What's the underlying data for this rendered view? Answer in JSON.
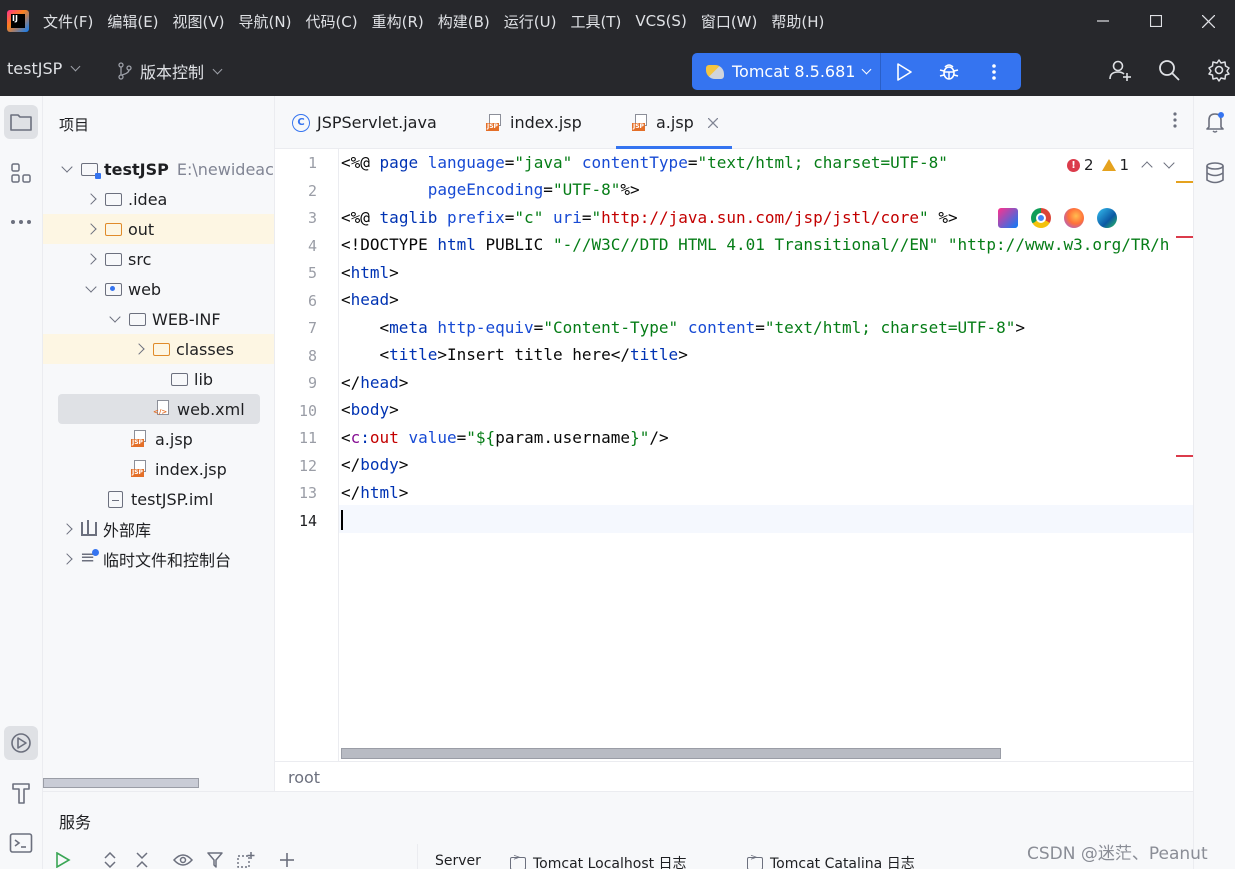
{
  "menu": {
    "items": [
      "文件(F)",
      "编辑(E)",
      "视图(V)",
      "导航(N)",
      "代码(C)",
      "重构(R)",
      "构建(B)",
      "运行(U)",
      "工具(T)",
      "VCS(S)",
      "窗口(W)",
      "帮助(H)"
    ]
  },
  "toolbar": {
    "project_name": "testJSP",
    "vcs_label": "版本控制",
    "run_config": "Tomcat 8.5.681"
  },
  "project_panel": {
    "title": "项目",
    "root_name": "testJSP",
    "root_path": "E:\\newideac",
    "tree": [
      "testJSP",
      ".idea",
      "out",
      "src",
      "web",
      "WEB-INF",
      "classes",
      "lib",
      "web.xml",
      "a.jsp",
      "index.jsp",
      "testJSP.iml",
      "外部库",
      "临时文件和控制台"
    ]
  },
  "editor": {
    "tabs": [
      "JSPServlet.java",
      "index.jsp",
      "a.jsp"
    ],
    "active_tab": "a.jsp",
    "error_count": "2",
    "warning_count": "1",
    "line_numbers": [
      "1",
      "2",
      "3",
      "4",
      "5",
      "6",
      "7",
      "8",
      "9",
      "10",
      "11",
      "12",
      "13",
      "14"
    ],
    "tokens": {
      "dir1": "<%@",
      "page": "page",
      "language": "language",
      "eq": "=",
      "java": "\"java\"",
      "contentType": "contentType",
      "ct_val": "\"text/html; charset=UTF-8\"",
      "indent2": "         ",
      "pageEncoding": "pageEncoding",
      "utf8": "\"UTF-8\"",
      "close_dir": "%>",
      "taglib": "taglib",
      "prefix": "prefix",
      "c": "\"c\"",
      "uri": "uri",
      "q": "\"",
      "uri_val": "http://java.sun.com/jsp/jstl/core",
      "close_dir3": " %>",
      "doctype": "<!DOCTYPE",
      "html_kw": "html",
      "public": " PUBLIC ",
      "dtd": "\"-//W3C//DTD HTML 4.01 Transitional//EN\"",
      "dtd_url": " \"http://www.w3.org/TR/h",
      "lt": "<",
      "gt": ">",
      "lt_slash": "</",
      "head": "head",
      "meta": "meta",
      "http_equiv": "http-equiv",
      "ct_type": "\"Content-Type\"",
      "content": "content",
      "title": "title",
      "title_text": "Insert title here",
      "body": "body",
      "c_prefix": "c",
      "colon": ":",
      "out": "out",
      "value": "value",
      "el_open": "\"${",
      "el_param": "param",
      "el_dot": ".",
      "el_user": "username",
      "el_close": "}\"",
      "slash_gt": "/>",
      "indent4": "    ",
      "space": " "
    }
  },
  "breadcrumb": {
    "text": "root"
  },
  "services": {
    "title": "服务",
    "tabs": [
      "Server",
      "Tomcat Localhost 日志",
      "Tomcat Catalina 日志"
    ]
  },
  "watermark": "CSDN @迷茫、Peanut",
  "colors": {
    "accent": "#3574f0",
    "error": "#db3b4b",
    "warning": "#e5a21e",
    "titlebar": "#27282c"
  }
}
